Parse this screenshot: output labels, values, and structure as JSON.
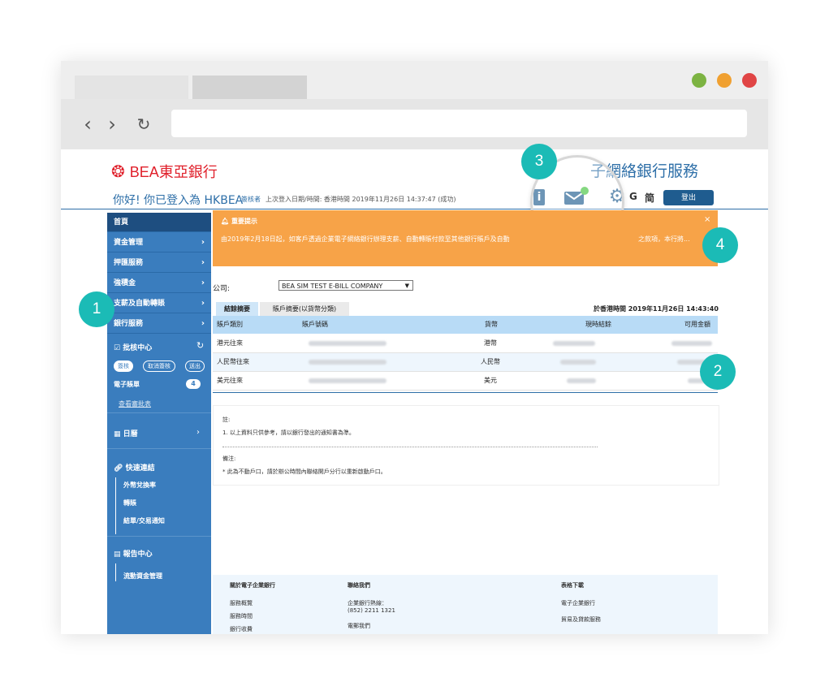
{
  "brand": {
    "logo_text": "BEA東亞銀行",
    "site_title": "子網絡銀行服務"
  },
  "header": {
    "greeting": "你好! 你已登入為 HKBEA",
    "role": "簽核者",
    "last_login": "上次登入日期/時間: 香港時間 2019年11月26日 14:37:47 (成功)",
    "lang_g": "G",
    "lang_simplified": "简",
    "logout_label": "登出",
    "info_icon_text": "i"
  },
  "callouts": [
    "1",
    "2",
    "3",
    "4"
  ],
  "sidebar": {
    "home": "首頁",
    "items": [
      {
        "label": "資金管理"
      },
      {
        "label": "押匯服務"
      },
      {
        "label": "強積金"
      },
      {
        "label": "支薪及自動轉賬"
      },
      {
        "label": "銀行服務"
      }
    ],
    "approval_center": "批核中心",
    "pills": [
      "簽核",
      "取消簽核",
      "送出"
    ],
    "ebill_label": "電子賬單",
    "ebill_count": "4",
    "view_all": "查看審批表",
    "calendar": "日曆",
    "quick_links": "快速連結",
    "quick_items": [
      "外幣兌換率",
      "轉賬",
      "結單/交易通知"
    ],
    "report_center": "報告中心",
    "report_items": [
      "流動資金管理"
    ]
  },
  "notice": {
    "title": "重要提示",
    "text": "由2019年2月18日起，如客戶透過企業電子網絡銀行辦理支薪、自動轉賬付款至其他銀行賬戶及自動",
    "text_tail": "之款項，本行將...",
    "close": "×"
  },
  "company": {
    "label": "公司:",
    "selected": "BEA SIM TEST E-BILL COMPANY"
  },
  "tabs": [
    "結餘摘要",
    "賬戶摘要(以貨幣分類)"
  ],
  "as_of": "於香港時間 2019年11月26日 14:43:40",
  "table": {
    "headers": [
      "賬戶類別",
      "賬戶號碼",
      "貨幣",
      "現時結餘",
      "可用金額"
    ],
    "rows": [
      {
        "type": "港元往來",
        "currency": "港幣"
      },
      {
        "type": "人民幣往來",
        "currency": "人民幣"
      },
      {
        "type": "美元往來",
        "currency": "美元"
      }
    ]
  },
  "notes": {
    "note_heading": "註:",
    "note_1": "1. 以上資料只供參考，請以銀行發出的通知書為準。",
    "remark_heading": "備注:",
    "remark_1": "*  此為不動戶口，請於辦公時間內聯絡開戶分行以重新啟動戶口。"
  },
  "footer": {
    "about": {
      "heading": "關於電子企業銀行",
      "items": [
        "服務概覽",
        "服務時間",
        "銀行收費"
      ]
    },
    "contact": {
      "heading": "聯絡我們",
      "hotline_label": "企業銀行熱線：",
      "hotline": "(852) 2211 1321",
      "email": "電郵我們"
    },
    "forms": {
      "heading": "表格下載",
      "items": [
        "電子企業銀行",
        "貿易及貸款服務"
      ]
    }
  },
  "colors": {
    "primary": "#3a7dbe",
    "dark_primary": "#1e4e80",
    "notice": "#f7a348",
    "badge": "#1bbbb6",
    "dot_green": "#7cb342",
    "dot_orange": "#f0a030",
    "dot_red": "#e04545"
  }
}
